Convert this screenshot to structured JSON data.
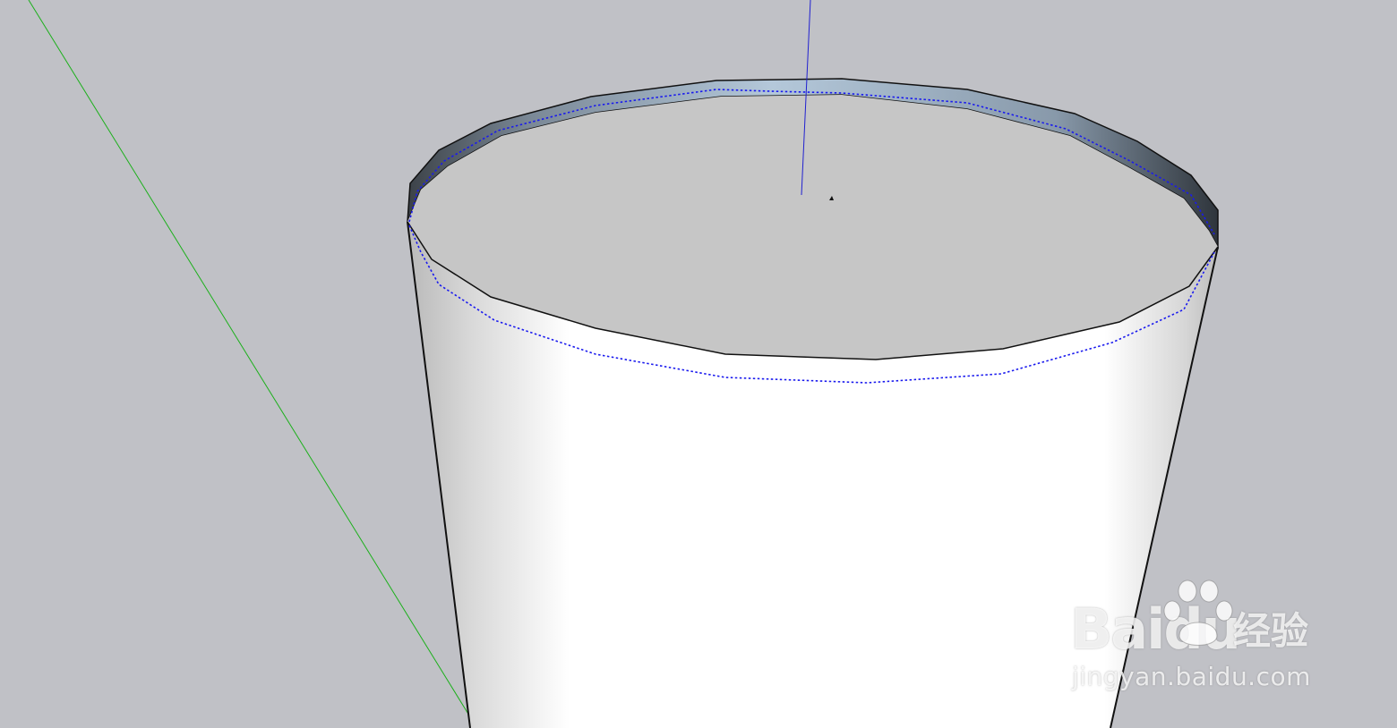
{
  "app": {
    "view": "3D modeling viewport",
    "background_color": "#c0c1c6"
  },
  "scene": {
    "axes": {
      "green_axis_color": "#1bb01b",
      "blue_axis_color": "#2020d0"
    },
    "model": {
      "object": "tapered cylinder with open top",
      "side_color": "#ffffff",
      "top_face_color": "#c6c6c6",
      "inner_rim_color": "#9fb4c9",
      "edge_color": "#111111",
      "selection_color": "#1a1aee"
    }
  },
  "watermark": {
    "brand_text": "Baidu",
    "cn_text": "经验",
    "url_text": "jingyan.baidu.com",
    "icon": "paw-icon"
  }
}
